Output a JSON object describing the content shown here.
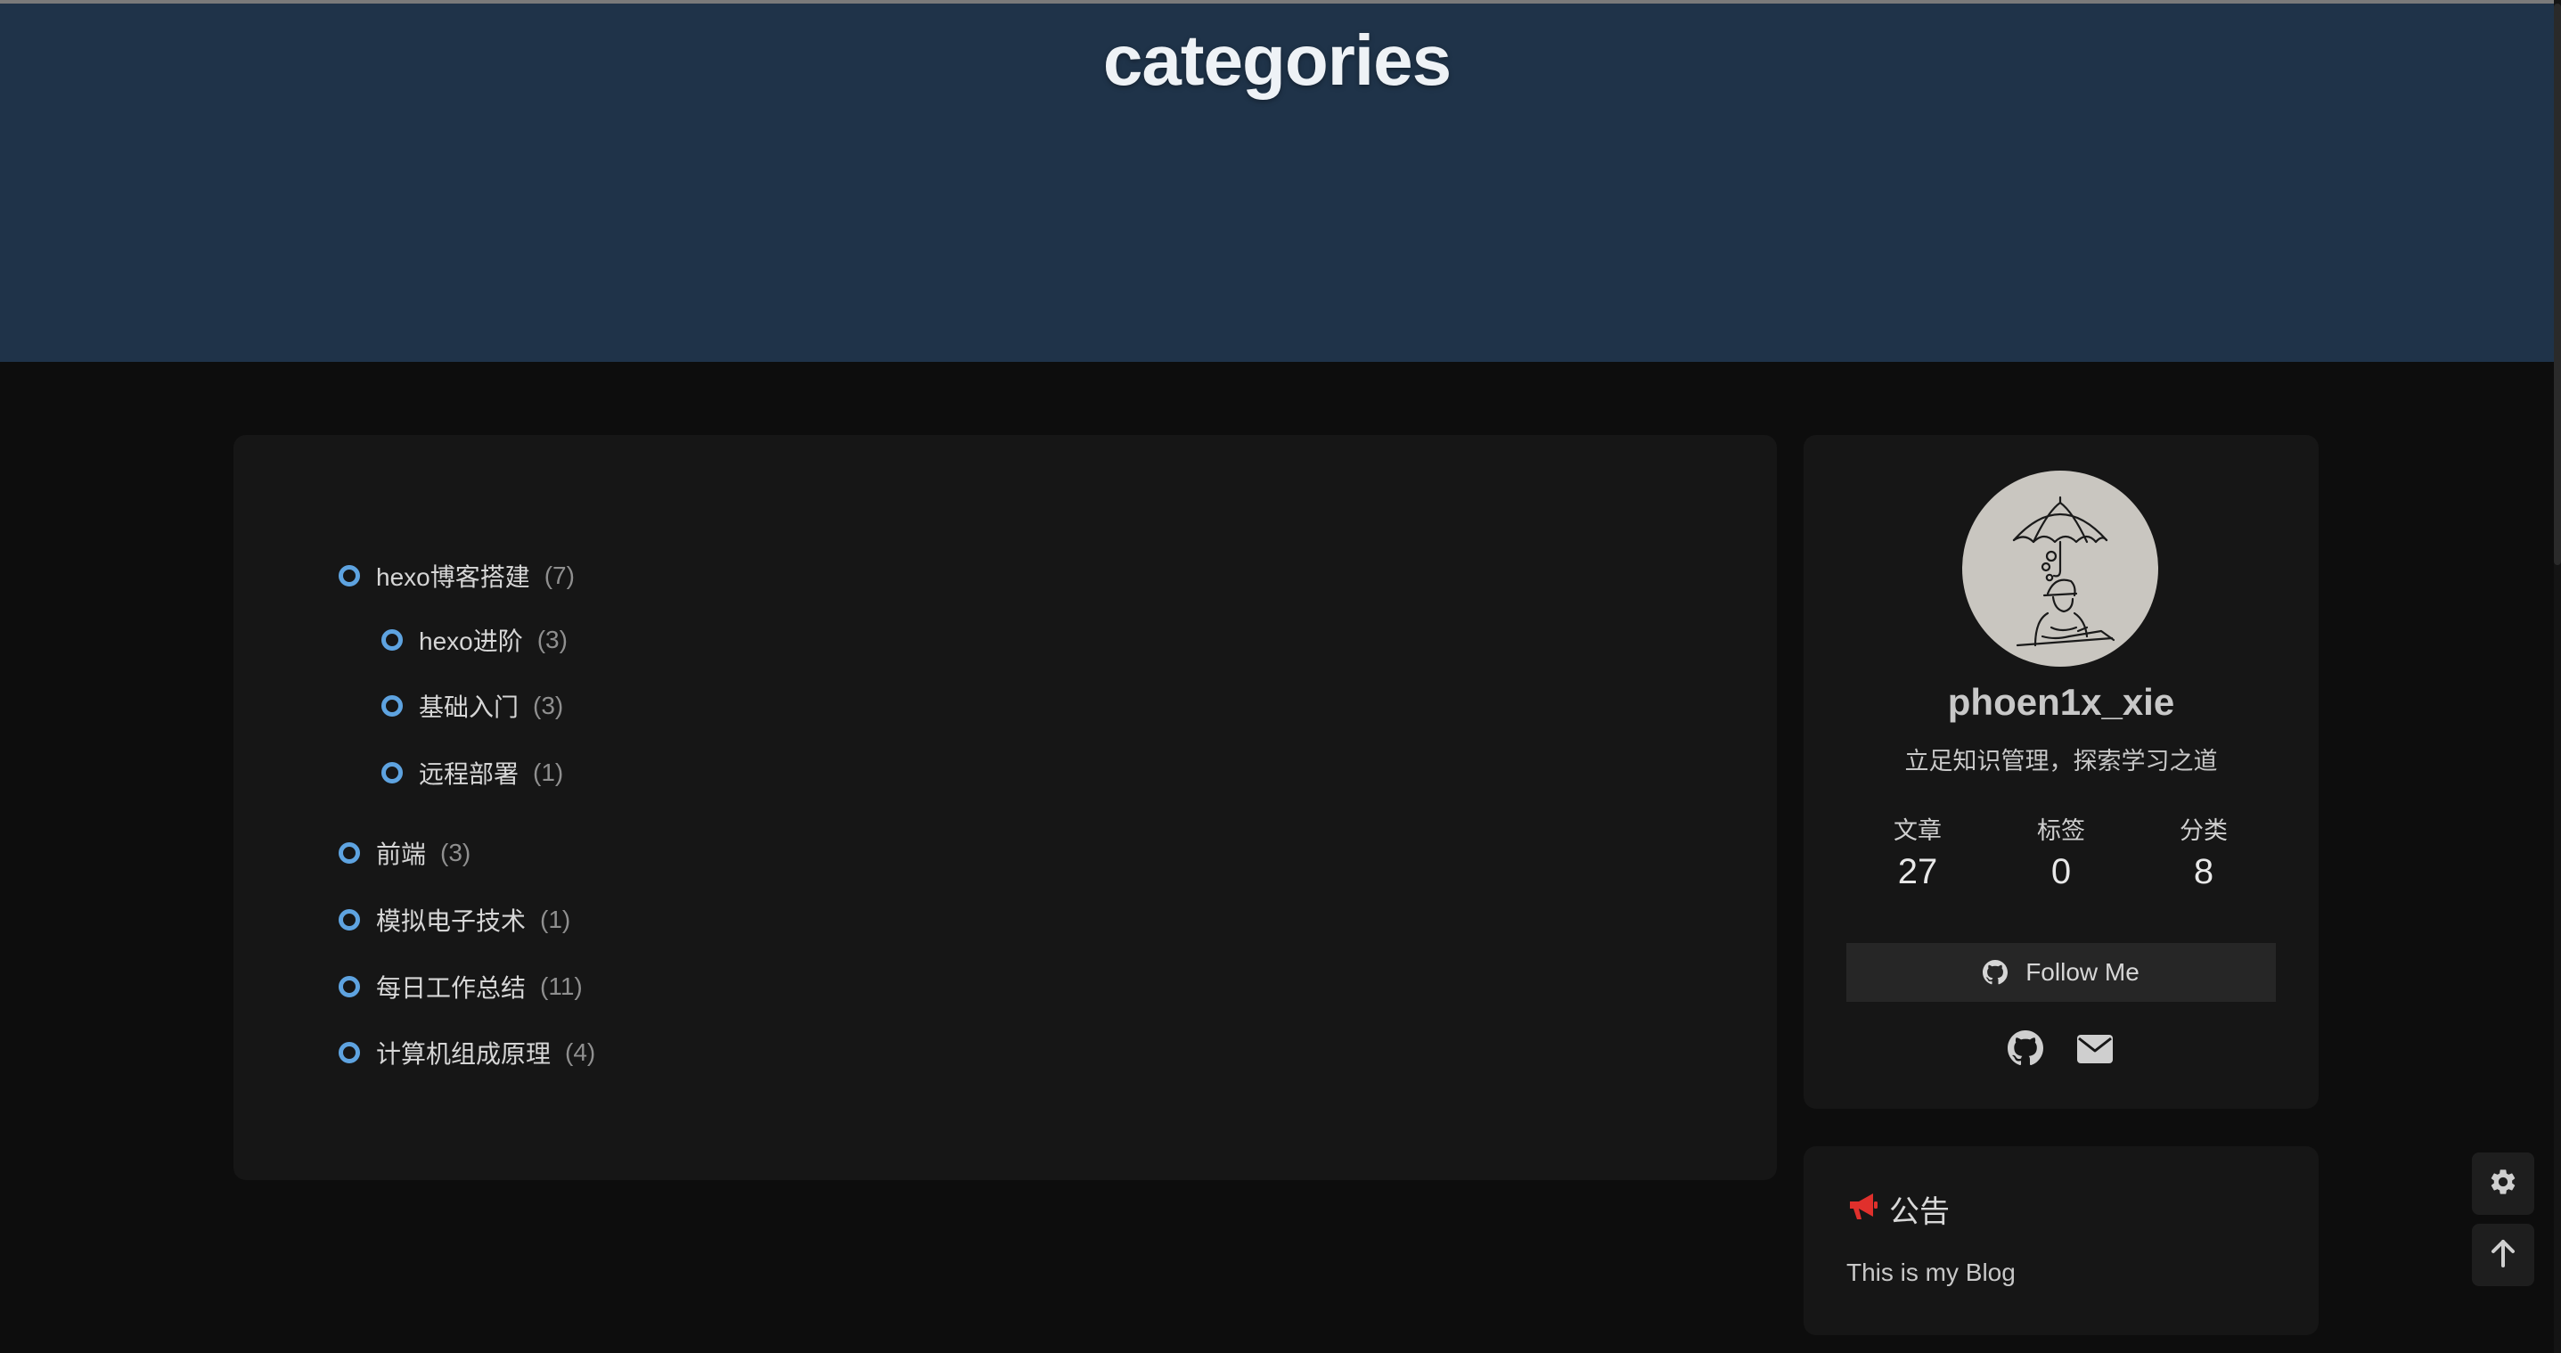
{
  "header": {
    "title": "categories"
  },
  "categories": [
    {
      "name": "hexo博客搭建",
      "count": "(7)"
    },
    {
      "name": "hexo进阶",
      "count": "(3)"
    },
    {
      "name": "基础入门",
      "count": "(3)"
    },
    {
      "name": "远程部署",
      "count": "(1)"
    },
    {
      "name": "前端",
      "count": "(3)"
    },
    {
      "name": "模拟电子技术",
      "count": "(1)"
    },
    {
      "name": "每日工作总结",
      "count": "(11)"
    },
    {
      "name": "计算机组成原理",
      "count": "(4)"
    }
  ],
  "profile": {
    "name": "phoen1x_xie",
    "description": "立足知识管理，探索学习之道",
    "stats": [
      {
        "label": "文章",
        "value": "27"
      },
      {
        "label": "标签",
        "value": "0"
      },
      {
        "label": "分类",
        "value": "8"
      }
    ],
    "follow_label": "Follow Me",
    "social_icons": [
      "github-icon",
      "envelope-icon"
    ]
  },
  "announcement": {
    "title": "公告",
    "body": "This is my Blog",
    "icon": "bullhorn-icon",
    "icon_color": "#e0302c"
  },
  "floating_buttons": [
    "gear-icon",
    "arrow-up-icon"
  ],
  "colors": {
    "header_bg": "#1f3349",
    "bullet": "#5ea3e0",
    "page_bg": "#0d0d0d",
    "card_bg": "#161616"
  }
}
